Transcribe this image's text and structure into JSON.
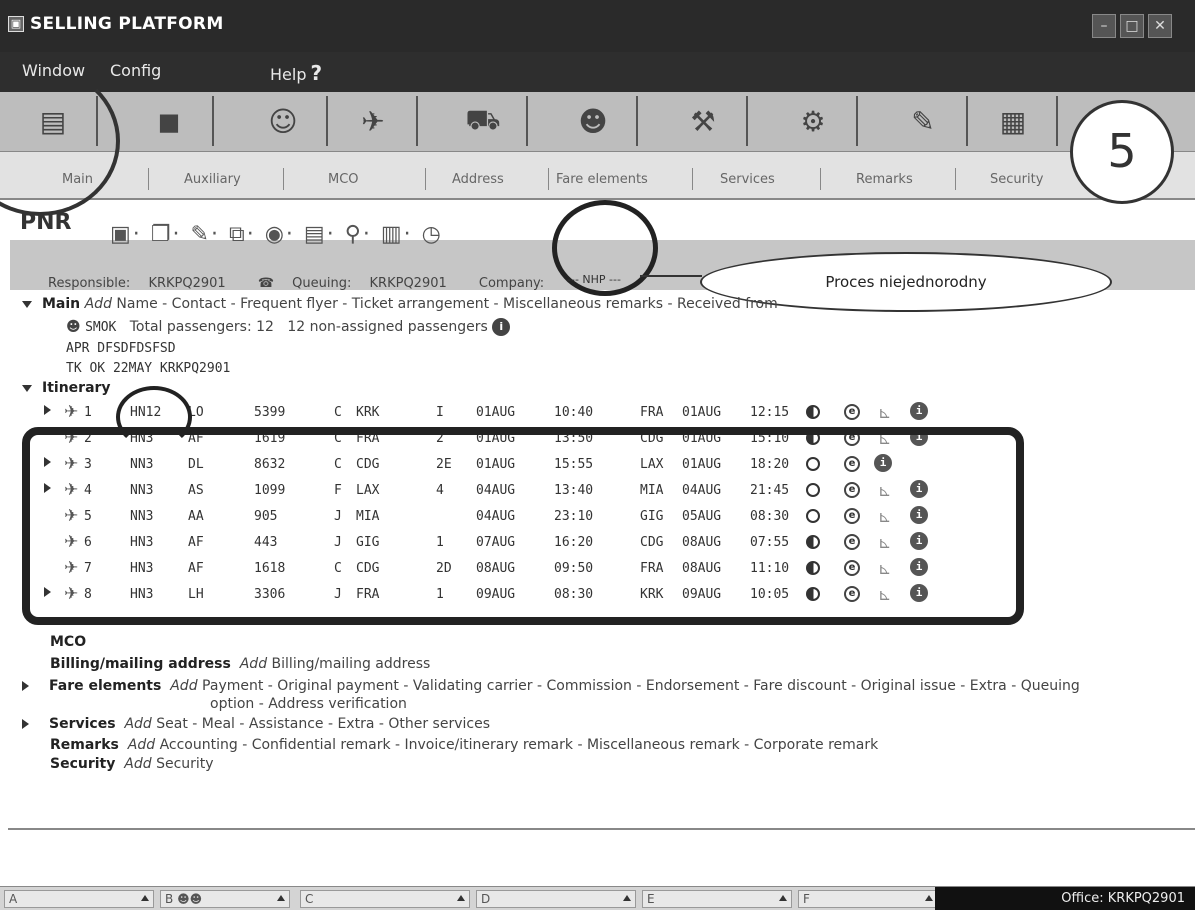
{
  "window": {
    "title": "SELLING PLATFORM",
    "icon": "app-window-icon"
  },
  "menu": {
    "window": "Window",
    "config": "Config",
    "help": "Help",
    "help_mark": "?"
  },
  "toolbar_icons": [
    "pnr-icon",
    "auxiliary-icon",
    "agent-icon",
    "air-icon",
    "car-icon",
    "person-icon",
    "tools-icon",
    "gear-icon",
    "notes-icon",
    "documents-icon"
  ],
  "annotation": {
    "number": "5",
    "callout": "Proces niejednorodny"
  },
  "section_tabs": [
    "Main",
    "Auxiliary",
    "MCO",
    "Address",
    "Fare elements",
    "Services",
    "Remarks",
    "Security"
  ],
  "pnr": {
    "title": "PNR",
    "nhp_label": "--- NHP ---",
    "responsible_label": "Responsible:",
    "responsible": "KRKPQ2901",
    "queuing_label": "Queuing:",
    "queuing": "KRKPQ2901",
    "company_label": "Company:",
    "main_label": "Main",
    "add_label": "Add",
    "main_options": "Name - Contact - Frequent flyer - Ticket arrangement - Miscellaneous remarks - Received from",
    "smok": "SMOK",
    "total_passengers": "Total passengers: 12",
    "non_assigned": "12 non-assigned passengers",
    "apr": "APR DFSDFDSFSD",
    "tk": "TK OK 22MAY KRKPQ2901",
    "itinerary_label": "Itinerary"
  },
  "segments": [
    {
      "n": "1",
      "status": "HN12",
      "airline": "LO",
      "flight": "5399",
      "cls": "C",
      "from": "KRK",
      "term": "I",
      "dep_date": "01AUG",
      "dep_time": "10:40",
      "to": "FRA",
      "arr_date": "01AUG",
      "arr_time": "12:15",
      "dot": "full",
      "e": true,
      "seat": true,
      "info": true,
      "arrow": true
    },
    {
      "n": "2",
      "status": "HN3",
      "airline": "AF",
      "flight": "1619",
      "cls": "C",
      "from": "FRA",
      "term": "2",
      "dep_date": "01AUG",
      "dep_time": "13:50",
      "to": "CDG",
      "arr_date": "01AUG",
      "arr_time": "15:10",
      "dot": "full",
      "e": true,
      "seat": true,
      "info": true,
      "arrow": false
    },
    {
      "n": "3",
      "status": "NN3",
      "airline": "DL",
      "flight": "8632",
      "cls": "C",
      "from": "CDG",
      "term": "2E",
      "dep_date": "01AUG",
      "dep_time": "15:55",
      "to": "LAX",
      "arr_date": "01AUG",
      "arr_time": "18:20",
      "dot": "empty",
      "e": true,
      "seat": false,
      "info": true,
      "arrow": true
    },
    {
      "n": "4",
      "status": "NN3",
      "airline": "AS",
      "flight": "1099",
      "cls": "F",
      "from": "LAX",
      "term": "4",
      "dep_date": "04AUG",
      "dep_time": "13:40",
      "to": "MIA",
      "arr_date": "04AUG",
      "arr_time": "21:45",
      "dot": "empty",
      "e": true,
      "seat": true,
      "info": true,
      "arrow": true
    },
    {
      "n": "5",
      "status": "NN3",
      "airline": "AA",
      "flight": "905",
      "cls": "J",
      "from": "MIA",
      "term": "",
      "dep_date": "04AUG",
      "dep_time": "23:10",
      "to": "GIG",
      "arr_date": "05AUG",
      "arr_time": "08:30",
      "dot": "empty",
      "e": true,
      "seat": true,
      "info": true,
      "arrow": false
    },
    {
      "n": "6",
      "status": "HN3",
      "airline": "AF",
      "flight": "443",
      "cls": "J",
      "from": "GIG",
      "term": "1",
      "dep_date": "07AUG",
      "dep_time": "16:20",
      "to": "CDG",
      "arr_date": "08AUG",
      "arr_time": "07:55",
      "dot": "full",
      "e": true,
      "seat": true,
      "info": true,
      "arrow": false
    },
    {
      "n": "7",
      "status": "HN3",
      "airline": "AF",
      "flight": "1618",
      "cls": "C",
      "from": "CDG",
      "term": "2D",
      "dep_date": "08AUG",
      "dep_time": "09:50",
      "to": "FRA",
      "arr_date": "08AUG",
      "arr_time": "11:10",
      "dot": "full",
      "e": true,
      "seat": true,
      "info": true,
      "arrow": false
    },
    {
      "n": "8",
      "status": "HN3",
      "airline": "LH",
      "flight": "3306",
      "cls": "J",
      "from": "FRA",
      "term": "1",
      "dep_date": "09AUG",
      "dep_time": "08:30",
      "to": "KRK",
      "arr_date": "09AUG",
      "arr_time": "10:05",
      "dot": "full",
      "e": true,
      "seat": true,
      "info": true,
      "arrow": true
    }
  ],
  "lower": {
    "mco": "MCO",
    "billing_label": "Billing/mailing address",
    "billing_add": "Add",
    "billing_opts": "Billing/mailing address",
    "fare_label": "Fare elements",
    "fare_add": "Add",
    "fare_opts": "Payment - Original payment - Validating carrier - Commission - Endorsement - Fare discount - Original issue - Extra - Queuing",
    "fare_opts2": "option - Address verification",
    "services_label": "Services",
    "services_add": "Add",
    "services_opts": "Seat - Meal - Assistance - Extra - Other services",
    "remarks_label": "Remarks",
    "remarks_add": "Add",
    "remarks_opts": "Accounting - Confidential remark - Invoice/itinerary remark - Miscellaneous remark - Corporate remark",
    "security_label": "Security",
    "security_add": "Add",
    "security_opts": "Security"
  },
  "status_bar": {
    "a": "A",
    "b": "B",
    "c": "C",
    "d": "D",
    "e": "E",
    "f": "F",
    "office": "Office: KRKPQ2901"
  }
}
